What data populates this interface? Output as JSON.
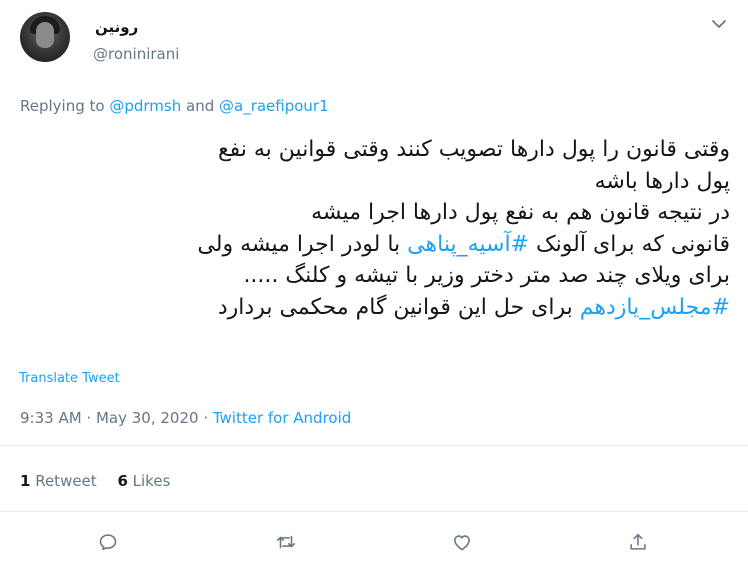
{
  "user": {
    "display_name": "رونین",
    "handle": "@roninirani"
  },
  "reply": {
    "prefix": "Replying to ",
    "mention1": "@pdrmsh",
    "and": " and ",
    "mention2": "@a_raefipour1"
  },
  "tweet": {
    "line1": "وقتی قانون را پول دارها تصویب کنند وقتی قوانین به نفع",
    "line2": "پول دارها باشه",
    "line3": "در نتیجه قانون هم به نفع پول دارها اجرا میشه",
    "line4_a": "قانونی که برای آلونک ",
    "line4_hashtag": "#آسیه_پناهی",
    "line4_b": "  با لودر اجرا میشه ولی",
    "line5": "برای ویلای چند صد متر دختر وزیر با تیشه و کلنگ .....",
    "line6_hashtag": "#مجلس_یازدهم",
    "line6_b": " برای حل این قوانین گام محکمی بردارد"
  },
  "translate_label": "Translate Tweet",
  "meta": {
    "time": "9:33 AM",
    "sep1": " · ",
    "date": "May 30, 2020",
    "sep2": " · ",
    "source": "Twitter for Android"
  },
  "stats": {
    "retweets_count": "1",
    "retweets_label": " Retweet",
    "likes_count": "6",
    "likes_label": " Likes"
  },
  "icons": {
    "more": "chevron-down-icon",
    "reply": "reply-icon",
    "retweet": "retweet-icon",
    "like": "heart-icon",
    "share": "share-icon"
  },
  "colors": {
    "accent": "#1da1f2",
    "secondary_text": "#657786",
    "primary_text": "#14171a",
    "divider": "#e6ecf0"
  }
}
